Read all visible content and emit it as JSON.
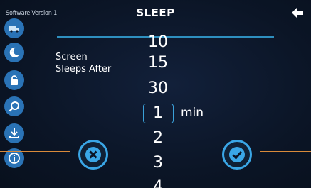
{
  "header": {
    "software_version": "Software Version 1",
    "title": "SLEEP"
  },
  "sidebar": {
    "items": [
      {
        "icon": "truck-icon"
      },
      {
        "icon": "moon-icon"
      },
      {
        "icon": "lock-icon"
      },
      {
        "icon": "search-icon"
      },
      {
        "icon": "download-icon"
      },
      {
        "icon": "info-icon"
      }
    ]
  },
  "setting": {
    "label_line1": "Screen",
    "label_line2": "Sleeps After"
  },
  "picker": {
    "options": [
      "10",
      "15",
      "30",
      "1",
      "2",
      "3",
      "4"
    ],
    "selected": "1",
    "unit": "min"
  },
  "actions": {
    "cancel_icon": "close-icon",
    "confirm_icon": "checkmark-icon"
  },
  "colors": {
    "accent": "#3aa6e6",
    "sidebar_icon_bg": "#2a73b6",
    "background": "#0b1526",
    "callout_line": "#d98a3a"
  }
}
